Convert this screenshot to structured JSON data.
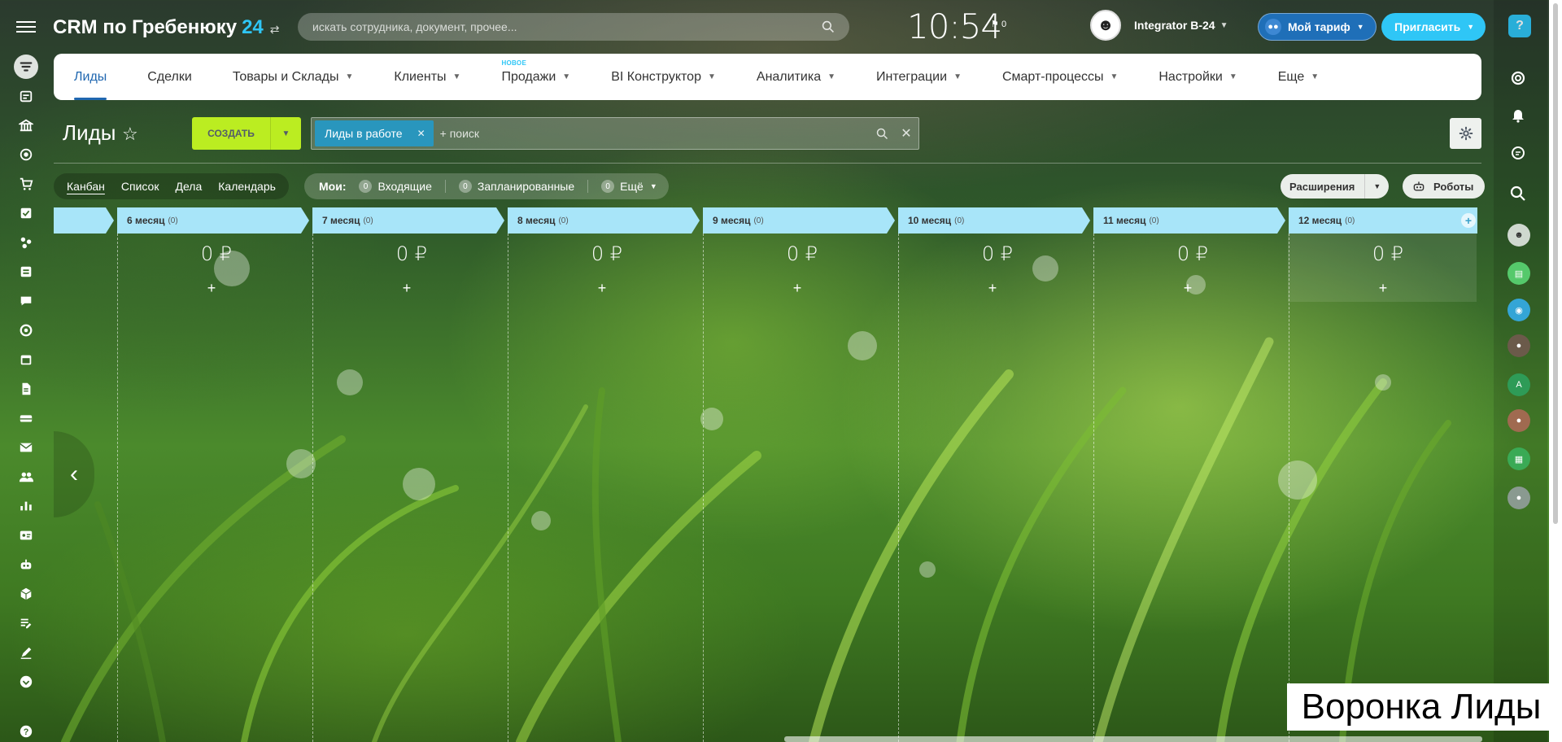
{
  "header": {
    "logo_text": "CRM по Гребенюку",
    "logo_num": "24",
    "search_placeholder": "искать сотрудника, документ, прочее...",
    "clock": "10:54",
    "flag_count": "0",
    "user_name": "Integrator B-24",
    "tariff_label": "Мой тариф",
    "invite_label": "Пригласить",
    "help": "?"
  },
  "nav": {
    "items": [
      {
        "label": "Лиды",
        "chevron": false
      },
      {
        "label": "Сделки",
        "chevron": false
      },
      {
        "label": "Товары и Склады",
        "chevron": true
      },
      {
        "label": "Клиенты",
        "chevron": true
      },
      {
        "label": "Продажи",
        "chevron": true,
        "badge": "НОВОЕ"
      },
      {
        "label": "BI Конструктор",
        "chevron": true
      },
      {
        "label": "Аналитика",
        "chevron": true
      },
      {
        "label": "Интеграции",
        "chevron": true
      },
      {
        "label": "Смарт-процессы",
        "chevron": true
      },
      {
        "label": "Настройки",
        "chevron": true
      },
      {
        "label": "Еще",
        "chevron": true
      }
    ]
  },
  "toolbar": {
    "page_title": "Лиды",
    "create_label": "СОЗДАТЬ",
    "filter_chip": "Лиды в работе",
    "filter_placeholder": "+ поиск"
  },
  "views": {
    "items": [
      "Канбан",
      "Список",
      "Дела",
      "Календарь"
    ],
    "mine_label": "Мои:",
    "counters": [
      {
        "count": "0",
        "label": "Входящие"
      },
      {
        "count": "0",
        "label": "Запланированные"
      },
      {
        "count": "0",
        "label": "Ещё"
      }
    ],
    "extensions_label": "Расширения",
    "robots_label": "Роботы"
  },
  "kanban": {
    "columns": [
      {
        "title": "6 месяц",
        "count": "(0)",
        "sum": "0 ₽"
      },
      {
        "title": "7 месяц",
        "count": "(0)",
        "sum": "0 ₽"
      },
      {
        "title": "8 месяц",
        "count": "(0)",
        "sum": "0 ₽"
      },
      {
        "title": "9 месяц",
        "count": "(0)",
        "sum": "0 ₽"
      },
      {
        "title": "10 месяц",
        "count": "(0)",
        "sum": "0 ₽"
      },
      {
        "title": "11 месяц",
        "count": "(0)",
        "sum": "0 ₽"
      },
      {
        "title": "12 месяц",
        "count": "(0)",
        "sum": "0 ₽"
      }
    ],
    "add_symbol": "+"
  },
  "caption": "Воронка Лиды",
  "colors": {
    "accent": "#2fc6f6",
    "create": "#bbed21",
    "stage": "#a8e5f9",
    "chip": "#2996bd",
    "nav_active": "#2067b0"
  }
}
